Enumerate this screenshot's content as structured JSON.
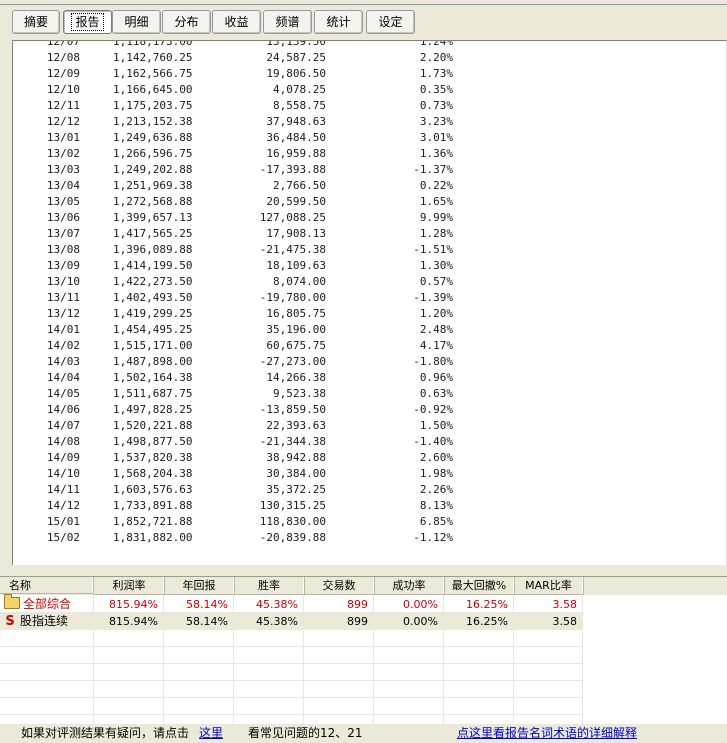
{
  "tabs": [
    {
      "label": "摘要",
      "active": false
    },
    {
      "label": "报告",
      "active": true
    },
    {
      "label": "明细",
      "active": false
    },
    {
      "label": "分布",
      "active": false
    },
    {
      "label": "收益",
      "active": false
    },
    {
      "label": "频谱",
      "active": false
    },
    {
      "label": "统计",
      "active": false
    },
    {
      "label": "设定",
      "active": false
    }
  ],
  "report_rows": [
    [
      "12/07",
      "1,118,173.00",
      "13,139.50",
      "1.24%"
    ],
    [
      "12/08",
      "1,142,760.25",
      "24,587.25",
      "2.20%"
    ],
    [
      "12/09",
      "1,162,566.75",
      "19,806.50",
      "1.73%"
    ],
    [
      "12/10",
      "1,166,645.00",
      "4,078.25",
      "0.35%"
    ],
    [
      "12/11",
      "1,175,203.75",
      "8,558.75",
      "0.73%"
    ],
    [
      "12/12",
      "1,213,152.38",
      "37,948.63",
      "3.23%"
    ],
    [
      "13/01",
      "1,249,636.88",
      "36,484.50",
      "3.01%"
    ],
    [
      "13/02",
      "1,266,596.75",
      "16,959.88",
      "1.36%"
    ],
    [
      "13/03",
      "1,249,202.88",
      "-17,393.88",
      "-1.37%"
    ],
    [
      "13/04",
      "1,251,969.38",
      "2,766.50",
      "0.22%"
    ],
    [
      "13/05",
      "1,272,568.88",
      "20,599.50",
      "1.65%"
    ],
    [
      "13/06",
      "1,399,657.13",
      "127,088.25",
      "9.99%"
    ],
    [
      "13/07",
      "1,417,565.25",
      "17,908.13",
      "1.28%"
    ],
    [
      "13/08",
      "1,396,089.88",
      "-21,475.38",
      "-1.51%"
    ],
    [
      "13/09",
      "1,414,199.50",
      "18,109.63",
      "1.30%"
    ],
    [
      "13/10",
      "1,422,273.50",
      "8,074.00",
      "0.57%"
    ],
    [
      "13/11",
      "1,402,493.50",
      "-19,780.00",
      "-1.39%"
    ],
    [
      "13/12",
      "1,419,299.25",
      "16,805.75",
      "1.20%"
    ],
    [
      "14/01",
      "1,454,495.25",
      "35,196.00",
      "2.48%"
    ],
    [
      "14/02",
      "1,515,171.00",
      "60,675.75",
      "4.17%"
    ],
    [
      "14/03",
      "1,487,898.00",
      "-27,273.00",
      "-1.80%"
    ],
    [
      "14/04",
      "1,502,164.38",
      "14,266.38",
      "0.96%"
    ],
    [
      "14/05",
      "1,511,687.75",
      "9,523.38",
      "0.63%"
    ],
    [
      "14/06",
      "1,497,828.25",
      "-13,859.50",
      "-0.92%"
    ],
    [
      "14/07",
      "1,520,221.88",
      "22,393.63",
      "1.50%"
    ],
    [
      "14/08",
      "1,498,877.50",
      "-21,344.38",
      "-1.40%"
    ],
    [
      "14/09",
      "1,537,820.38",
      "38,942.88",
      "2.60%"
    ],
    [
      "14/10",
      "1,568,204.38",
      "30,384.00",
      "1.98%"
    ],
    [
      "14/11",
      "1,603,576.63",
      "35,372.25",
      "2.26%"
    ],
    [
      "14/12",
      "1,733,891.88",
      "130,315.25",
      "8.13%"
    ],
    [
      "15/01",
      "1,852,721.88",
      "118,830.00",
      "6.85%"
    ],
    [
      "15/02",
      "1,831,882.00",
      "-20,839.88",
      "-1.12%"
    ]
  ],
  "summary": {
    "headers": [
      "名称",
      "利润率",
      "年回报",
      "胜率",
      "交易数",
      "成功率",
      "最大回撤%",
      "MAR比率"
    ],
    "rows": [
      {
        "icon": "folder-icon",
        "name": "全部综合",
        "values": [
          "815.94%",
          "58.14%",
          "45.38%",
          "899",
          "0.00%",
          "16.25%",
          "3.58"
        ],
        "red": true
      },
      {
        "icon": "strategy-s-icon",
        "icon_glyph": "S",
        "name": "股指连续",
        "values": [
          "815.94%",
          "58.14%",
          "45.38%",
          "899",
          "0.00%",
          "16.25%",
          "3.58"
        ],
        "red": false
      }
    ]
  },
  "footer": {
    "question_text": "如果对评测结果有疑问，请点击",
    "here_link": "这里",
    "faq_text": "看常见问题的12、21",
    "glossary_link": "点这里看报告名词术语的详细解释"
  },
  "colors": {
    "red_text": "#cc0000",
    "link": "#0000cc",
    "panel_bg": "#ece9d8"
  }
}
